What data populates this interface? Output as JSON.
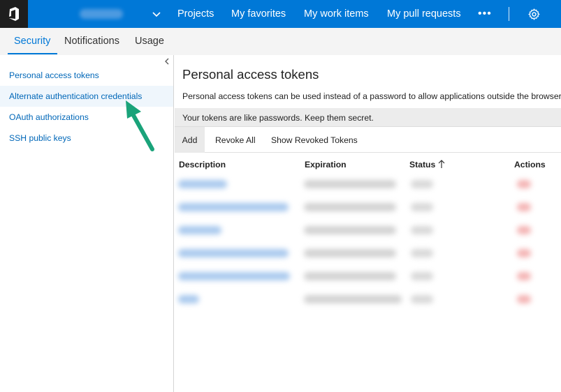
{
  "topnav": {
    "links": [
      "Projects",
      "My favorites",
      "My work items",
      "My pull requests"
    ],
    "more": "•••"
  },
  "subnav": {
    "tabs": [
      "Security",
      "Notifications",
      "Usage"
    ],
    "active": "Security"
  },
  "sidebar": {
    "items": [
      {
        "label": "Personal access tokens"
      },
      {
        "label": "Alternate authentication credentials"
      },
      {
        "label": "OAuth authorizations"
      },
      {
        "label": "SSH public keys"
      }
    ],
    "selected": "Alternate authentication credentials"
  },
  "main": {
    "title": "Personal access tokens",
    "description": "Personal access tokens can be used instead of a password to allow applications outside the browser ac",
    "warning": "Your tokens are like passwords. Keep them secret.",
    "toolbar": {
      "add": "Add",
      "revoke_all": "Revoke All",
      "show_revoked": "Show Revoked Tokens"
    },
    "table": {
      "headers": [
        "Description",
        "Expiration",
        "Status",
        "Actions"
      ],
      "sorted_column": "Status",
      "row_count_blurred": 6
    }
  },
  "colors": {
    "brand_blue": "#0078d7",
    "logo_bg": "#1e1e1e",
    "arrow_green": "#1aa37a"
  }
}
